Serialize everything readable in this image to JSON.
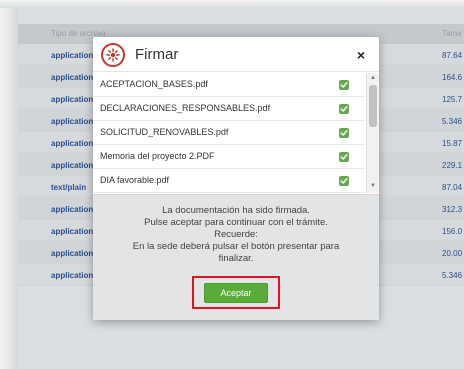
{
  "background_table": {
    "header": {
      "type_col": "Tipo de archivo",
      "size_col": "Tama"
    },
    "rows": [
      {
        "type": "application",
        "size": "87.64"
      },
      {
        "type": "application",
        "size": "164.6"
      },
      {
        "type": "application",
        "size": "125.7"
      },
      {
        "type": "application",
        "size": "5.346"
      },
      {
        "type": "application",
        "size": "15.87"
      },
      {
        "type": "application",
        "size": "229.1"
      },
      {
        "type": "text/plain",
        "size": "87.04"
      },
      {
        "type": "application",
        "size": "312.3"
      },
      {
        "type": "application",
        "size": "156.0"
      },
      {
        "type": "application",
        "size": "20.00"
      },
      {
        "type": "application",
        "size": "5.346"
      }
    ]
  },
  "dialog": {
    "title": "Firmar",
    "icon": "signature-icon",
    "close_label": "×",
    "files": [
      {
        "name": "ACEPTACION_BASES.pdf",
        "status": "signed"
      },
      {
        "name": "DECLARACIONES_RESPONSABLES.pdf",
        "status": "signed"
      },
      {
        "name": "SOLICITUD_RENOVABLES.pdf",
        "status": "signed"
      },
      {
        "name": "Memoria del proyecto 2.PDF",
        "status": "signed"
      },
      {
        "name": "DIA favorable.pdf",
        "status": "signed"
      }
    ],
    "message": [
      "La documentación ha sido firmada.",
      "Pulse aceptar para continuar con el trámite.",
      "Recuerde:",
      "En la sede deberá pulsar el botón presentar para",
      "finalizar."
    ],
    "accept_label": "Aceptar"
  },
  "colors": {
    "accent_green": "#5aac38",
    "highlight_red": "#e0141e",
    "icon_red": "#c0392b",
    "link_blue": "#2a4f8f"
  }
}
